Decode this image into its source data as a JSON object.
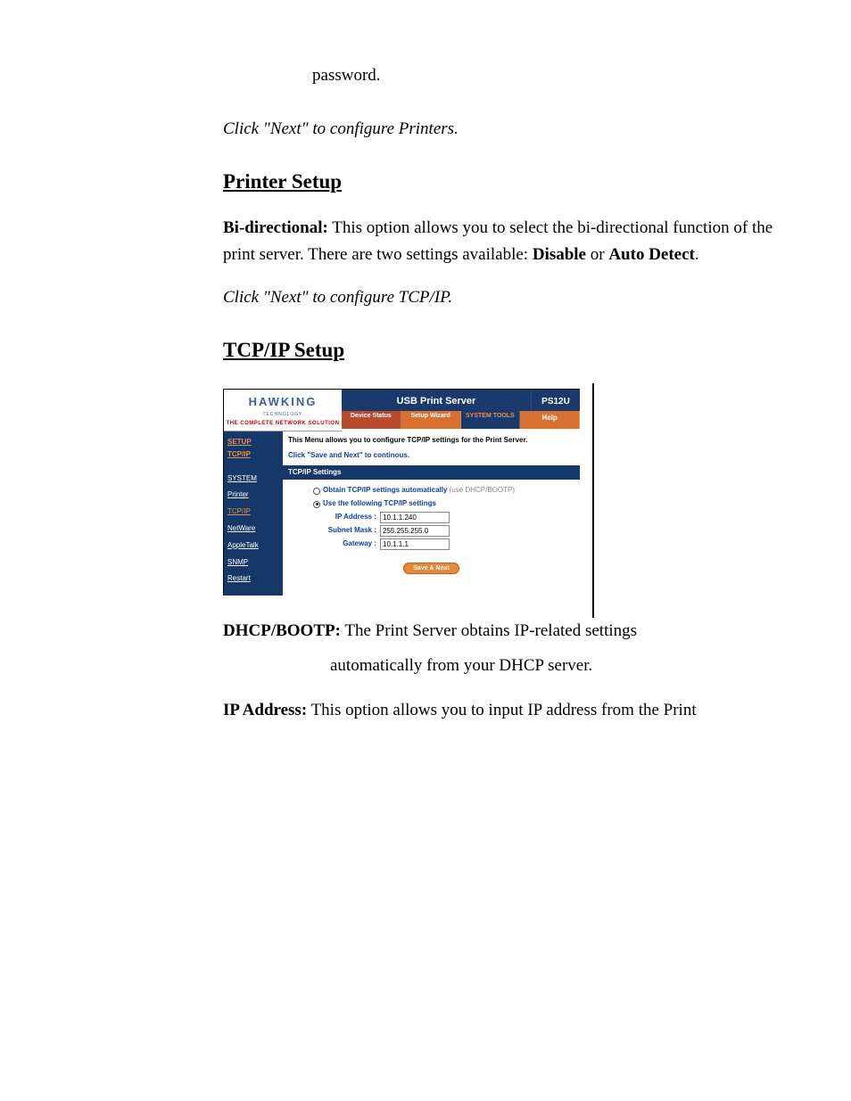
{
  "top_text": "password.",
  "instruction1": "Click \"Next\" to configure Printers.",
  "section1": {
    "heading": "Printer Setup",
    "body_prefix": "Bi-directional:",
    "body_text": " This option allows you to select the bi-directional function of the print server. There are two settings available: ",
    "opt1": "Disable",
    "mid": " or ",
    "opt2": "Auto Detect",
    "suffix": "."
  },
  "instruction2": "Click \"Next\" to configure TCP/IP.",
  "section2": {
    "heading": "TCP/IP Setup"
  },
  "screenshot": {
    "logo": "HAWKING",
    "logo_sub": "TECHNOLOGY",
    "logo_tag": "THE COMPLETE NETWORK SOLUTION",
    "banner_title": "USB Print Server",
    "banner_model": "PS12U",
    "tabs": {
      "device": "Device Status",
      "setup": "Setup Wizard",
      "system": "SYSTEM TOOLS",
      "help": "Help"
    },
    "sidebar": {
      "head1": "SETUP",
      "head2": "TCP/IP",
      "items": [
        "SYSTEM",
        "Printer",
        "TCP/IP",
        "NetWare",
        "AppleTalk",
        "SNMP",
        "Restart"
      ]
    },
    "content": {
      "intro": "This Menu allows you to configure TCP/IP settings for the Print Server.",
      "sub": "Click \"Save and Next\" to continous.",
      "band": "TCP/IP Settings",
      "radio1": "Obtain TCP/IP settings automatically",
      "radio1_gray": " (use DHCP/BOOTP)",
      "radio2": "Use the following TCP/IP settings",
      "fields": {
        "ip_label": "IP Address :",
        "ip_value": "10.1.1.240",
        "mask_label": "Subnet Mask :",
        "mask_value": "255.255.255.0",
        "gw_label": "Gateway :",
        "gw_value": "10.1.1.1"
      },
      "button": "Save & Next"
    }
  },
  "desc1": {
    "prefix": "DHCP/BOOTP:",
    "line1": " The Print Server obtains IP-related settings",
    "line2": "automatically from your DHCP server."
  },
  "desc2": {
    "prefix": "IP Address:",
    "text": " This option allows you to input IP address from the Print"
  }
}
